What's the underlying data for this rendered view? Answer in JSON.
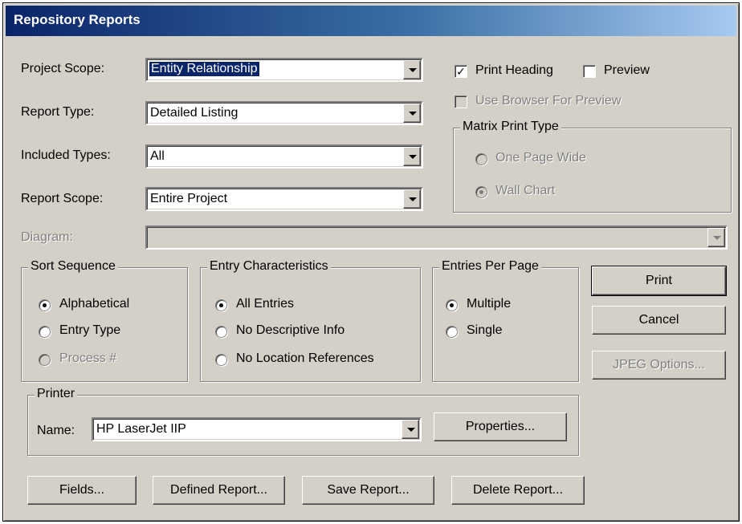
{
  "window": {
    "title": "Repository Reports"
  },
  "project_scope": {
    "label": "Project Scope:",
    "value": "Entity Relationship"
  },
  "report_type": {
    "label": "Report Type:",
    "value": "Detailed Listing"
  },
  "included_types": {
    "label": "Included Types:",
    "value": "All"
  },
  "report_scope": {
    "label": "Report Scope:",
    "value": "Entire Project"
  },
  "diagram": {
    "label": "Diagram:",
    "value": ""
  },
  "print_heading": {
    "label": "Print Heading",
    "checked": true
  },
  "preview": {
    "label": "Preview",
    "checked": false
  },
  "use_browser": {
    "label": "Use Browser For Preview",
    "checked": false,
    "enabled": false
  },
  "matrix_print_type": {
    "legend": "Matrix Print Type",
    "options": [
      {
        "label": "One Page Wide",
        "selected": false
      },
      {
        "label": "Wall Chart",
        "selected": true
      }
    ]
  },
  "sort_sequence": {
    "legend": "Sort Sequence",
    "options": [
      {
        "label": "Alphabetical",
        "selected": true
      },
      {
        "label": "Entry Type",
        "selected": false
      },
      {
        "label": "Process #",
        "selected": false,
        "enabled": false
      }
    ]
  },
  "entry_characteristics": {
    "legend": "Entry Characteristics",
    "options": [
      {
        "label": "All Entries",
        "selected": true
      },
      {
        "label": "No Descriptive Info",
        "selected": false
      },
      {
        "label": "No Location References",
        "selected": false
      }
    ]
  },
  "entries_per_page": {
    "legend": "Entries Per Page",
    "options": [
      {
        "label": "Multiple",
        "selected": true
      },
      {
        "label": "Single",
        "selected": false
      }
    ]
  },
  "buttons": {
    "print": "Print",
    "cancel": "Cancel",
    "jpeg_options": "JPEG Options...",
    "properties": "Properties...",
    "fields": "Fields...",
    "defined_report": "Defined Report...",
    "save_report": "Save Report...",
    "delete_report": "Delete Report..."
  },
  "printer": {
    "legend": "Printer",
    "name_label": "Name:",
    "value": "HP LaserJet IIP"
  },
  "colors": {
    "face": "#d4d0c8",
    "title_start": "#0a246a",
    "title_end": "#a6caf0",
    "selection": "#0a246a"
  }
}
